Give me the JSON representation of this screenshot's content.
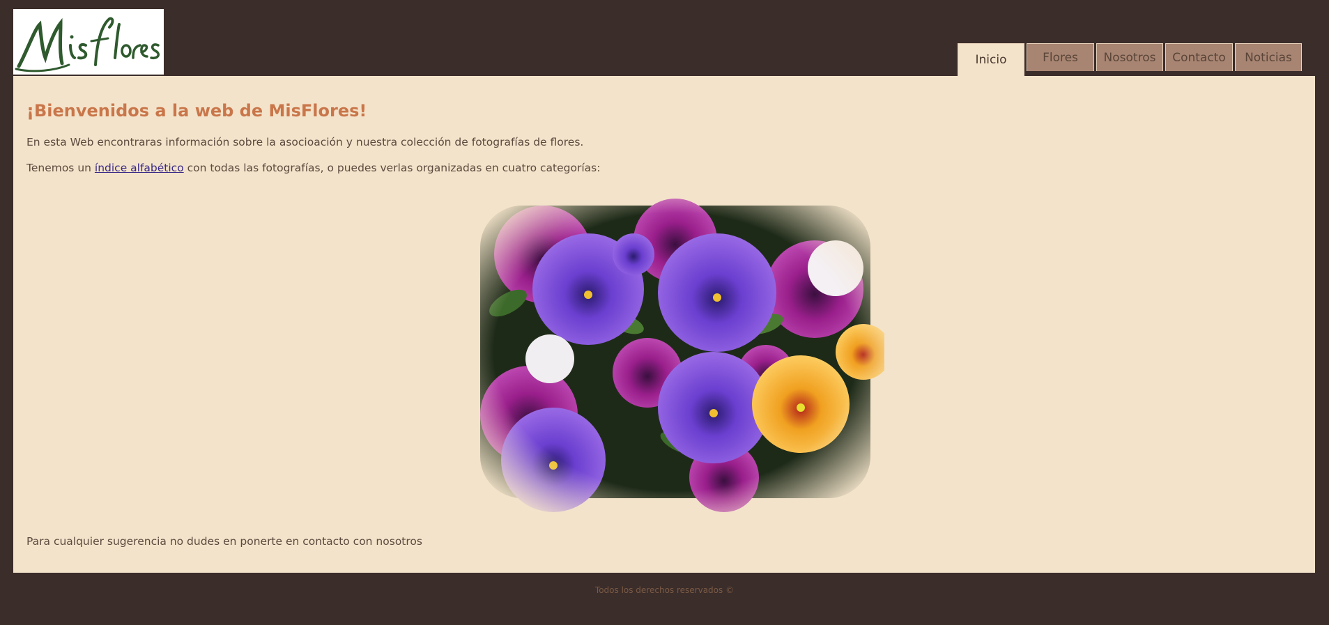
{
  "brand": {
    "logo_text": "MisFlores",
    "logo_color": "#2f5a2e"
  },
  "nav": {
    "tabs": [
      {
        "label": "Inicio",
        "active": true
      },
      {
        "label": "Flores",
        "active": false
      },
      {
        "label": "Nosotros",
        "active": false
      },
      {
        "label": "Contacto",
        "active": false
      },
      {
        "label": "Noticias",
        "active": false
      }
    ]
  },
  "main": {
    "heading": "¡Bienvenidos a la web de MisFlores!",
    "intro": "En esta Web encontraras información sobre la asocioación y nuestra colección de fotografías de flores.",
    "index_before": "Tenemos un ",
    "index_link": "índice alfabético",
    "index_after": " con todas las fotografías, o puedes verlas organizadas en cuatro categorías:",
    "contact_note": "Para cualquier sugerencia no dudes en ponerte en contacto con nosotros"
  },
  "footer": {
    "text": "Todos los derechos reservados ©"
  },
  "colors": {
    "page_bg": "#3b2d2a",
    "content_bg": "#f3e3ca",
    "heading": "#c9764a",
    "tab_bg": "#a88573",
    "link": "#3a2a88"
  }
}
